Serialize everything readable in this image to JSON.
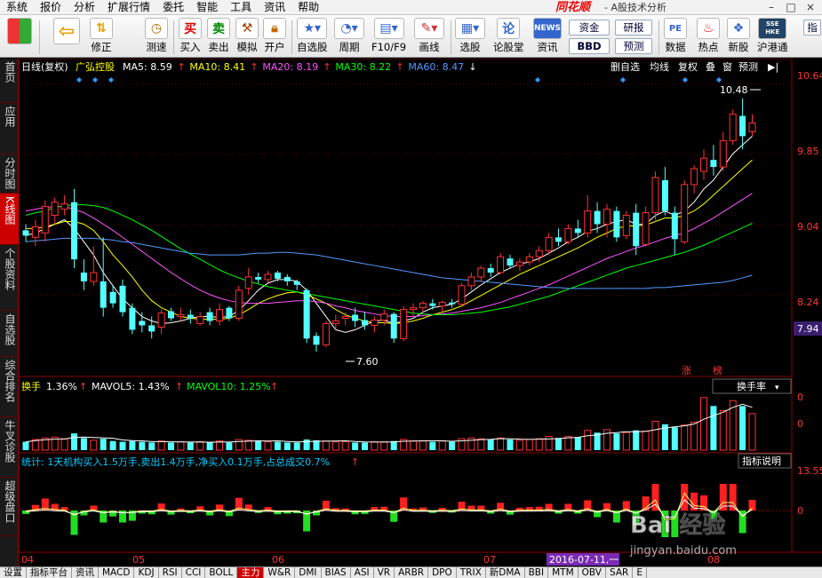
{
  "menu": {
    "items": [
      "系统",
      "报价",
      "分析",
      "扩展行情",
      "委托",
      "智能",
      "工具",
      "资讯",
      "帮助"
    ],
    "brand": "同花顺",
    "app_title": "- A股技术分析"
  },
  "toolbar": {
    "buttons": [
      {
        "label": "",
        "icon": "grid-icon"
      },
      {
        "label": "",
        "icon": "back-arrow-icon"
      },
      {
        "label": "修正",
        "icon": "arrow-updown-icon"
      },
      {
        "label": "测速",
        "icon": "clock-icon"
      },
      {
        "label": "买入",
        "icon": "buy-icon",
        "icon_text": "买"
      },
      {
        "label": "卖出",
        "icon": "sell-icon",
        "icon_text": "卖"
      },
      {
        "label": "模拟",
        "icon": "hammer-icon"
      },
      {
        "label": "开户",
        "icon": "lock-icon"
      },
      {
        "label": "自选股",
        "icon": "star-icon"
      },
      {
        "label": "周期",
        "icon": "period-icon"
      },
      {
        "label": "F10/F9",
        "icon": "f10-icon"
      },
      {
        "label": "画线",
        "icon": "pen-icon"
      },
      {
        "label": "选股",
        "icon": "select-stock-icon"
      },
      {
        "label": "论股堂",
        "icon": "forum-icon",
        "icon_text": "论"
      },
      {
        "label": "资讯",
        "icon": "news-icon",
        "icon_text": "NEWS"
      },
      {
        "label": "数据",
        "icon": "pe-icon",
        "icon_text": "PE"
      },
      {
        "label": "热点",
        "icon": "hot-icon"
      },
      {
        "label": "新股",
        "icon": "new-stock-icon"
      },
      {
        "label": "沪港通",
        "icon": "hk-connect-icon",
        "icon_text": "SSE HKE"
      }
    ],
    "boxes": [
      "资金",
      "BBD",
      "研报",
      "预测"
    ],
    "more": "指"
  },
  "left_tabs": [
    {
      "label": "首页"
    },
    {
      "label": "应用"
    },
    {
      "label": "分时图"
    },
    {
      "label": "K线图",
      "active": true
    },
    {
      "label": "个股资料"
    },
    {
      "label": "自选股"
    },
    {
      "label": "综合排名"
    },
    {
      "label": "牛叉诊股"
    },
    {
      "label": "超级盘口"
    }
  ],
  "stock": {
    "period": "日线(复权)",
    "name": "广弘控股"
  },
  "ma_indicators": [
    {
      "label": "MA5",
      "value": "8.59",
      "arrow": "↑",
      "color": "#ffffff"
    },
    {
      "label": "MA10",
      "value": "8.41",
      "arrow": "↑",
      "color": "#ffff00"
    },
    {
      "label": "MA20",
      "value": "8.19",
      "arrow": "↑",
      "color": "#ff55ff"
    },
    {
      "label": "MA30",
      "value": "8.22",
      "arrow": "↑",
      "color": "#00ff00"
    },
    {
      "label": "MA60",
      "value": "8.47",
      "arrow": "↓",
      "color": "#5599ff"
    }
  ],
  "chart_tools": [
    "删自选",
    "均线",
    "复权",
    "叠",
    "窗",
    "预测",
    "▶|"
  ],
  "price_axis": {
    "ticks": [
      "10.64",
      "9.85",
      "9.04",
      "8.24"
    ],
    "current": "7.94"
  },
  "annotations": {
    "high": "10.48",
    "low": "7.60",
    "tag_rise": "涨",
    "tag_list": "榜"
  },
  "turnover": {
    "label": "换手",
    "value": "1.36%",
    "mavol5": "MAVOL5: 1.43%",
    "mavol10": "MAVOL10: 1.25%",
    "selector": "换手率",
    "axis": [
      "0",
      "0"
    ]
  },
  "stats": {
    "text": "统计: 1天机构买入1.5万手,卖出1.4万手,净买入0.1万手,占总成交0.7%",
    "button": "指标说明",
    "axis": [
      "13.55",
      "0"
    ]
  },
  "date_axis": {
    "months": [
      "04",
      "05",
      "06",
      "07",
      "08"
    ],
    "cursor_date": "2016-07-11,一"
  },
  "watermark": {
    "brand": "Bai 经验",
    "url": "jingyan.baidu.com"
  },
  "bottom_tabs": [
    "设置",
    "指标平台",
    "资讯",
    "MACD",
    "KDJ",
    "RSI",
    "CCI",
    "BOLL",
    "主力",
    "W&R",
    "DMI",
    "BIAS",
    "ASI",
    "VR",
    "ARBR",
    "DPO",
    "TRIX",
    "新DMA",
    "BBI",
    "MTM",
    "OBV",
    "SAR",
    "E"
  ],
  "bottom_active": "主力",
  "chart_data": {
    "type": "candlestick",
    "price_range": [
      7.4,
      10.75
    ],
    "candles": [
      {
        "o": 8.98,
        "h": 9.05,
        "l": 8.85,
        "c": 8.92
      },
      {
        "o": 8.9,
        "h": 9.1,
        "l": 8.8,
        "c": 9.02
      },
      {
        "o": 8.95,
        "h": 9.32,
        "l": 8.85,
        "c": 9.25
      },
      {
        "o": 9.15,
        "h": 9.35,
        "l": 9.05,
        "c": 9.3
      },
      {
        "o": 9.22,
        "h": 9.38,
        "l": 9.15,
        "c": 9.28
      },
      {
        "o": 9.3,
        "h": 9.45,
        "l": 8.55,
        "c": 8.65
      },
      {
        "o": 8.5,
        "h": 8.65,
        "l": 8.3,
        "c": 8.4
      },
      {
        "o": 8.4,
        "h": 8.8,
        "l": 8.35,
        "c": 8.5
      },
      {
        "o": 8.4,
        "h": 8.9,
        "l": 8.0,
        "c": 8.1
      },
      {
        "o": 8.28,
        "h": 8.35,
        "l": 8.1,
        "c": 8.15
      },
      {
        "o": 8.35,
        "h": 8.42,
        "l": 8.0,
        "c": 8.05
      },
      {
        "o": 8.1,
        "h": 8.15,
        "l": 7.8,
        "c": 7.85
      },
      {
        "o": 7.95,
        "h": 8.05,
        "l": 7.82,
        "c": 7.9
      },
      {
        "o": 7.9,
        "h": 8.0,
        "l": 7.75,
        "c": 7.83
      },
      {
        "o": 7.88,
        "h": 8.08,
        "l": 7.8,
        "c": 8.04
      },
      {
        "o": 8.06,
        "h": 8.1,
        "l": 7.95,
        "c": 7.98
      },
      {
        "o": 8.0,
        "h": 8.1,
        "l": 7.95,
        "c": 8.02
      },
      {
        "o": 8.02,
        "h": 8.08,
        "l": 7.92,
        "c": 7.98
      },
      {
        "o": 7.92,
        "h": 8.05,
        "l": 7.9,
        "c": 8.0
      },
      {
        "o": 8.05,
        "h": 8.1,
        "l": 7.9,
        "c": 7.95
      },
      {
        "o": 7.95,
        "h": 8.15,
        "l": 7.9,
        "c": 8.08
      },
      {
        "o": 8.1,
        "h": 8.12,
        "l": 7.95,
        "c": 7.98
      },
      {
        "o": 7.98,
        "h": 8.35,
        "l": 7.95,
        "c": 8.3
      },
      {
        "o": 8.32,
        "h": 8.55,
        "l": 8.25,
        "c": 8.45
      },
      {
        "o": 8.45,
        "h": 8.5,
        "l": 8.38,
        "c": 8.42
      },
      {
        "o": 8.42,
        "h": 8.52,
        "l": 8.38,
        "c": 8.48
      },
      {
        "o": 8.5,
        "h": 8.52,
        "l": 8.4,
        "c": 8.43
      },
      {
        "o": 8.45,
        "h": 8.48,
        "l": 8.35,
        "c": 8.4
      },
      {
        "o": 8.4,
        "h": 8.42,
        "l": 8.3,
        "c": 8.36
      },
      {
        "o": 8.3,
        "h": 8.32,
        "l": 7.7,
        "c": 7.75
      },
      {
        "o": 7.78,
        "h": 7.82,
        "l": 7.6,
        "c": 7.68
      },
      {
        "o": 7.68,
        "h": 7.95,
        "l": 7.65,
        "c": 7.92
      },
      {
        "o": 7.92,
        "h": 8.02,
        "l": 7.85,
        "c": 7.95
      },
      {
        "o": 7.98,
        "h": 8.05,
        "l": 7.9,
        "c": 8.0
      },
      {
        "o": 8.02,
        "h": 8.1,
        "l": 7.88,
        "c": 7.95
      },
      {
        "o": 7.96,
        "h": 8.05,
        "l": 7.85,
        "c": 7.9
      },
      {
        "o": 7.9,
        "h": 8.0,
        "l": 7.82,
        "c": 7.96
      },
      {
        "o": 7.96,
        "h": 8.08,
        "l": 7.9,
        "c": 8.03
      },
      {
        "o": 8.03,
        "h": 8.05,
        "l": 7.7,
        "c": 7.75
      },
      {
        "o": 7.75,
        "h": 8.12,
        "l": 7.72,
        "c": 8.08
      },
      {
        "o": 8.08,
        "h": 8.15,
        "l": 8.0,
        "c": 8.1
      },
      {
        "o": 8.1,
        "h": 8.18,
        "l": 8.05,
        "c": 8.15
      },
      {
        "o": 8.15,
        "h": 8.2,
        "l": 8.08,
        "c": 8.12
      },
      {
        "o": 8.12,
        "h": 8.18,
        "l": 8.05,
        "c": 8.16
      },
      {
        "o": 8.16,
        "h": 8.2,
        "l": 8.1,
        "c": 8.14
      },
      {
        "o": 8.14,
        "h": 8.38,
        "l": 8.12,
        "c": 8.35
      },
      {
        "o": 8.35,
        "h": 8.5,
        "l": 8.3,
        "c": 8.45
      },
      {
        "o": 8.45,
        "h": 8.58,
        "l": 8.4,
        "c": 8.55
      },
      {
        "o": 8.55,
        "h": 8.6,
        "l": 8.45,
        "c": 8.5
      },
      {
        "o": 8.5,
        "h": 8.72,
        "l": 8.48,
        "c": 8.68
      },
      {
        "o": 8.66,
        "h": 8.7,
        "l": 8.55,
        "c": 8.58
      },
      {
        "o": 8.58,
        "h": 8.66,
        "l": 8.52,
        "c": 8.62
      },
      {
        "o": 8.62,
        "h": 8.72,
        "l": 8.58,
        "c": 8.68
      },
      {
        "o": 8.68,
        "h": 8.8,
        "l": 8.62,
        "c": 8.75
      },
      {
        "o": 8.75,
        "h": 8.95,
        "l": 8.7,
        "c": 8.9
      },
      {
        "o": 8.9,
        "h": 9.0,
        "l": 8.8,
        "c": 8.85
      },
      {
        "o": 8.85,
        "h": 9.05,
        "l": 8.82,
        "c": 9.0
      },
      {
        "o": 9.0,
        "h": 9.1,
        "l": 8.9,
        "c": 8.95
      },
      {
        "o": 8.95,
        "h": 9.38,
        "l": 8.9,
        "c": 9.2
      },
      {
        "o": 9.2,
        "h": 9.3,
        "l": 8.95,
        "c": 9.05
      },
      {
        "o": 9.05,
        "h": 9.28,
        "l": 8.9,
        "c": 9.22
      },
      {
        "o": 9.2,
        "h": 9.25,
        "l": 8.85,
        "c": 8.9
      },
      {
        "o": 8.92,
        "h": 9.2,
        "l": 8.88,
        "c": 9.15
      },
      {
        "o": 9.18,
        "h": 9.28,
        "l": 8.7,
        "c": 8.8
      },
      {
        "o": 8.82,
        "h": 9.25,
        "l": 8.8,
        "c": 9.18
      },
      {
        "o": 9.18,
        "h": 9.65,
        "l": 9.1,
        "c": 9.58
      },
      {
        "o": 9.55,
        "h": 9.7,
        "l": 9.15,
        "c": 9.2
      },
      {
        "o": 9.18,
        "h": 9.25,
        "l": 8.7,
        "c": 8.88
      },
      {
        "o": 8.85,
        "h": 9.55,
        "l": 8.82,
        "c": 9.5
      },
      {
        "o": 9.5,
        "h": 9.72,
        "l": 9.4,
        "c": 9.68
      },
      {
        "o": 9.65,
        "h": 9.9,
        "l": 9.55,
        "c": 9.8
      },
      {
        "o": 9.78,
        "h": 9.95,
        "l": 9.6,
        "c": 9.7
      },
      {
        "o": 9.7,
        "h": 10.1,
        "l": 9.65,
        "c": 10.0
      },
      {
        "o": 10.0,
        "h": 10.35,
        "l": 9.95,
        "c": 10.3
      },
      {
        "o": 10.28,
        "h": 10.48,
        "l": 9.9,
        "c": 10.05
      },
      {
        "o": 10.1,
        "h": 10.3,
        "l": 10.05,
        "c": 10.2
      }
    ],
    "turnover_pct": [
      1.1,
      1.4,
      1.6,
      1.7,
      1.5,
      2.2,
      1.6,
      1.3,
      1.5,
      1.2,
      1.1,
      1.2,
      1.1,
      1.0,
      1.2,
      1.0,
      1.1,
      1.0,
      1.1,
      1.0,
      1.2,
      1.0,
      1.4,
      1.3,
      1.2,
      1.1,
      1.1,
      1.0,
      1.0,
      1.4,
      1.3,
      1.2,
      1.1,
      1.1,
      1.0,
      1.0,
      1.1,
      1.1,
      1.2,
      1.4,
      1.2,
      1.2,
      1.1,
      1.2,
      1.1,
      1.5,
      1.6,
      1.5,
      1.4,
      1.6,
      1.4,
      1.3,
      1.4,
      1.5,
      1.8,
      1.6,
      1.8,
      1.7,
      2.6,
      2.3,
      2.7,
      2.2,
      2.3,
      2.6,
      2.5,
      3.8,
      3.4,
      3.0,
      3.3,
      3.7,
      6.9,
      5.8,
      5.2,
      6.5,
      5.8,
      4.8
    ],
    "ma_lines": {
      "MA5": [
        8.92,
        8.95,
        9.0,
        9.05,
        9.1,
        9.0,
        8.85,
        8.7,
        8.5,
        8.35,
        8.2,
        8.1,
        8.0,
        7.95,
        7.92,
        7.93,
        7.95,
        7.98,
        8.0,
        8.0,
        7.99,
        8.0,
        8.07,
        8.18,
        8.3,
        8.38,
        8.42,
        8.42,
        8.4,
        8.3,
        8.15,
        8.0,
        7.85,
        7.82,
        7.85,
        7.9,
        7.95,
        7.96,
        7.92,
        7.95,
        7.98,
        8.05,
        8.1,
        8.12,
        8.14,
        8.2,
        8.28,
        8.36,
        8.43,
        8.5,
        8.55,
        8.6,
        8.62,
        8.66,
        8.72,
        8.78,
        8.85,
        8.9,
        8.97,
        9.0,
        9.05,
        9.08,
        9.1,
        9.05,
        9.05,
        9.15,
        9.2,
        9.15,
        9.2,
        9.3,
        9.45,
        9.55,
        9.7,
        9.85,
        9.95,
        10.05
      ],
      "MA10": [
        9.0,
        9.0,
        9.02,
        9.05,
        9.08,
        9.08,
        9.05,
        8.98,
        8.85,
        8.7,
        8.58,
        8.45,
        8.3,
        8.18,
        8.1,
        8.05,
        8.0,
        7.98,
        7.97,
        7.97,
        7.97,
        7.98,
        8.02,
        8.08,
        8.15,
        8.2,
        8.24,
        8.27,
        8.28,
        8.25,
        8.2,
        8.15,
        8.08,
        8.02,
        7.98,
        7.95,
        7.93,
        7.93,
        7.92,
        7.93,
        7.95,
        7.98,
        8.02,
        8.05,
        8.08,
        8.12,
        8.18,
        8.24,
        8.3,
        8.36,
        8.42,
        8.48,
        8.53,
        8.58,
        8.63,
        8.68,
        8.73,
        8.78,
        8.84,
        8.9,
        8.95,
        9.0,
        9.03,
        9.03,
        9.04,
        9.08,
        9.12,
        9.12,
        9.15,
        9.2,
        9.28,
        9.38,
        9.48,
        9.58,
        9.68,
        9.78
      ],
      "MA20": [
        9.2,
        9.22,
        9.24,
        9.25,
        9.25,
        9.22,
        9.18,
        9.12,
        9.05,
        8.98,
        8.9,
        8.82,
        8.74,
        8.66,
        8.58,
        8.5,
        8.43,
        8.36,
        8.3,
        8.25,
        8.21,
        8.18,
        8.16,
        8.15,
        8.15,
        8.15,
        8.16,
        8.17,
        8.18,
        8.18,
        8.17,
        8.15,
        8.12,
        8.1,
        8.07,
        8.05,
        8.03,
        8.01,
        8.0,
        8.0,
        8.0,
        8.01,
        8.02,
        8.03,
        8.04,
        8.06,
        8.08,
        8.1,
        8.13,
        8.16,
        8.2,
        8.24,
        8.28,
        8.32,
        8.36,
        8.41,
        8.46,
        8.51,
        8.56,
        8.61,
        8.66,
        8.7,
        8.74,
        8.78,
        8.81,
        8.85,
        8.89,
        8.92,
        8.95,
        9.0,
        9.06,
        9.12,
        9.19,
        9.26,
        9.33,
        9.4
      ],
      "MA30": [
        9.15,
        9.18,
        9.2,
        9.24,
        9.26,
        9.27,
        9.27,
        9.26,
        9.24,
        9.2,
        9.15,
        9.1,
        9.04,
        8.98,
        8.91,
        8.84,
        8.77,
        8.71,
        8.65,
        8.59,
        8.53,
        8.48,
        8.44,
        8.4,
        8.37,
        8.34,
        8.32,
        8.3,
        8.28,
        8.26,
        8.24,
        8.22,
        8.2,
        8.18,
        8.16,
        8.14,
        8.12,
        8.1,
        8.08,
        8.06,
        8.04,
        8.03,
        8.02,
        8.02,
        8.02,
        8.03,
        8.04,
        8.05,
        8.07,
        8.09,
        8.11,
        8.14,
        8.17,
        8.2,
        8.23,
        8.27,
        8.31,
        8.35,
        8.39,
        8.43,
        8.47,
        8.51,
        8.55,
        8.58,
        8.61,
        8.64,
        8.67,
        8.7,
        8.73,
        8.77,
        8.81,
        8.86,
        8.91,
        8.96,
        9.01,
        9.06
      ],
      "MA60": [
        8.85,
        8.86,
        8.87,
        8.88,
        8.89,
        8.89,
        8.89,
        8.89,
        8.88,
        8.87,
        8.85,
        8.84,
        8.82,
        8.8,
        8.78,
        8.76,
        8.74,
        8.72,
        8.71,
        8.7,
        8.7,
        8.7,
        8.7,
        8.71,
        8.72,
        8.72,
        8.73,
        8.73,
        8.72,
        8.71,
        8.7,
        8.68,
        8.66,
        8.64,
        8.62,
        8.6,
        8.58,
        8.56,
        8.54,
        8.52,
        8.5,
        8.48,
        8.46,
        8.44,
        8.43,
        8.42,
        8.41,
        8.4,
        8.39,
        8.38,
        8.37,
        8.36,
        8.35,
        8.34,
        8.33,
        8.33,
        8.32,
        8.32,
        8.32,
        8.32,
        8.32,
        8.32,
        8.32,
        8.32,
        8.32,
        8.33,
        8.33,
        8.34,
        8.35,
        8.36,
        8.37,
        8.38,
        8.39,
        8.41,
        8.44,
        8.47
      ]
    }
  }
}
